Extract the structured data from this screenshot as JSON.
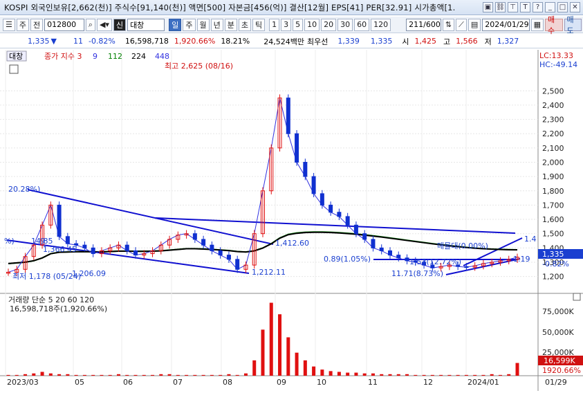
{
  "title": "KOSPI 외국인보유[2,662(천)] 주식수[91,140(천)] 액면[500] 자본금[456(억)] 결산[12월] EPS[41] PER[32.91] 시가총액[1.",
  "toolbar": {
    "market": "주",
    "prefix": "전",
    "code": "012800",
    "name": "대창",
    "credit_badge": "신",
    "periods": [
      "일",
      "주",
      "월",
      "년",
      "분",
      "초",
      "틱"
    ],
    "selected_period": "일",
    "intervals": [
      "1",
      "3",
      "5",
      "10",
      "20",
      "30",
      "60",
      "120"
    ],
    "count": "211/600",
    "date": "2024/01/29",
    "buy_label": "매수",
    "sell_label": "매도"
  },
  "quote": {
    "price": "1,335",
    "arrow": "▼",
    "change": "11",
    "change_pct": "-0.82%",
    "volume": "16,598,718",
    "volume_pct": "1,920.66%",
    "turnover": "18.21%",
    "amount": "24,524백만",
    "bid_label": "최우선",
    "bid": "1,339",
    "ask": "1,335",
    "open_label": "시",
    "open": "1,425",
    "high_label": "고",
    "high": "1,566",
    "low_label": "저",
    "low": "1,327"
  },
  "chart": {
    "name_tag": "대창",
    "legend_title": "종가 지수 3",
    "ma_periods": [
      "9",
      "112",
      "224",
      "448"
    ],
    "ma_colors": [
      "#d01010",
      "#3030e0",
      "#008000",
      "#000000",
      "#3030e0"
    ],
    "lc": "LC:13.33",
    "hc": "HC:-49.14",
    "high_annot": "최고 2,625 (08/16)",
    "low_annot": "최저 1,178 (05/24)",
    "current_price_label": "1,335",
    "current_pct_label": "-0.82%",
    "annotations": [
      "20.28%)",
      "1,366.45",
      "1,412.60",
      "1,212.11",
      "1,206.09",
      "0.89(1.05%)",
      "11.71(8.73%)",
      "1,53(12.72%)",
      "매물대(0.00%)",
      "1.4",
      "1.19",
      "%)",
      "14.85",
      "9"
    ],
    "volume_legend": "거래량 단순 5 20 60 120",
    "volume_value": "16,598,718주(1,920.66%)",
    "volume_ticks": [
      "75,000K",
      "50,000K",
      "25,000K"
    ],
    "volume_current": "16,599K",
    "volume_pct_label": "1920.66%",
    "x_labels": [
      "2023/03",
      "05",
      "06",
      "07",
      "08",
      "09",
      "10",
      "11",
      "12",
      "2024/01"
    ],
    "right_date": "01/29"
  },
  "chart_data": {
    "type": "line",
    "y_ticks": [
      2500,
      2400,
      2300,
      2200,
      2100,
      2000,
      1900,
      1800,
      1700,
      1600,
      1500,
      1400,
      1300,
      1200
    ],
    "ylim": [
      1140,
      2700
    ],
    "close": [
      1230,
      1250,
      1340,
      1420,
      1560,
      1700,
      1480,
      1430,
      1420,
      1400,
      1360,
      1380,
      1400,
      1420,
      1380,
      1350,
      1360,
      1380,
      1420,
      1460,
      1490,
      1500,
      1460,
      1420,
      1380,
      1350,
      1320,
      1250,
      1280,
      1500,
      1800,
      2100,
      2450,
      2200,
      2000,
      1900,
      1780,
      1700,
      1650,
      1620,
      1560,
      1500,
      1460,
      1400,
      1380,
      1350,
      1330,
      1310,
      1300,
      1280,
      1260,
      1270,
      1280,
      1270,
      1265,
      1275,
      1290,
      1300,
      1310,
      1320,
      1335
    ],
    "ma_long": [
      1290,
      1295,
      1300,
      1310,
      1330,
      1360,
      1370,
      1372,
      1374,
      1374,
      1373,
      1373,
      1375,
      1378,
      1378,
      1377,
      1377,
      1378,
      1380,
      1385,
      1390,
      1395,
      1395,
      1393,
      1390,
      1386,
      1382,
      1375,
      1372,
      1380,
      1400,
      1430,
      1470,
      1495,
      1505,
      1510,
      1512,
      1512,
      1510,
      1507,
      1503,
      1498,
      1492,
      1485,
      1478,
      1470,
      1462,
      1454,
      1446,
      1438,
      1430,
      1423,
      1416,
      1410,
      1404,
      1399,
      1395,
      1392,
      1390,
      1388,
      1387
    ],
    "volume": [
      1,
      1,
      2,
      3,
      5,
      3,
      2,
      2,
      1,
      1,
      1,
      1,
      1,
      2,
      1,
      1,
      1,
      1,
      2,
      2,
      1,
      1,
      1,
      1,
      1,
      1,
      2,
      1,
      3,
      20,
      60,
      95,
      80,
      50,
      30,
      20,
      12,
      8,
      6,
      5,
      4,
      4,
      3,
      3,
      2,
      2,
      2,
      2,
      1,
      1,
      1,
      1,
      1,
      1,
      1,
      1,
      1,
      2,
      1,
      2,
      16.6
    ]
  }
}
